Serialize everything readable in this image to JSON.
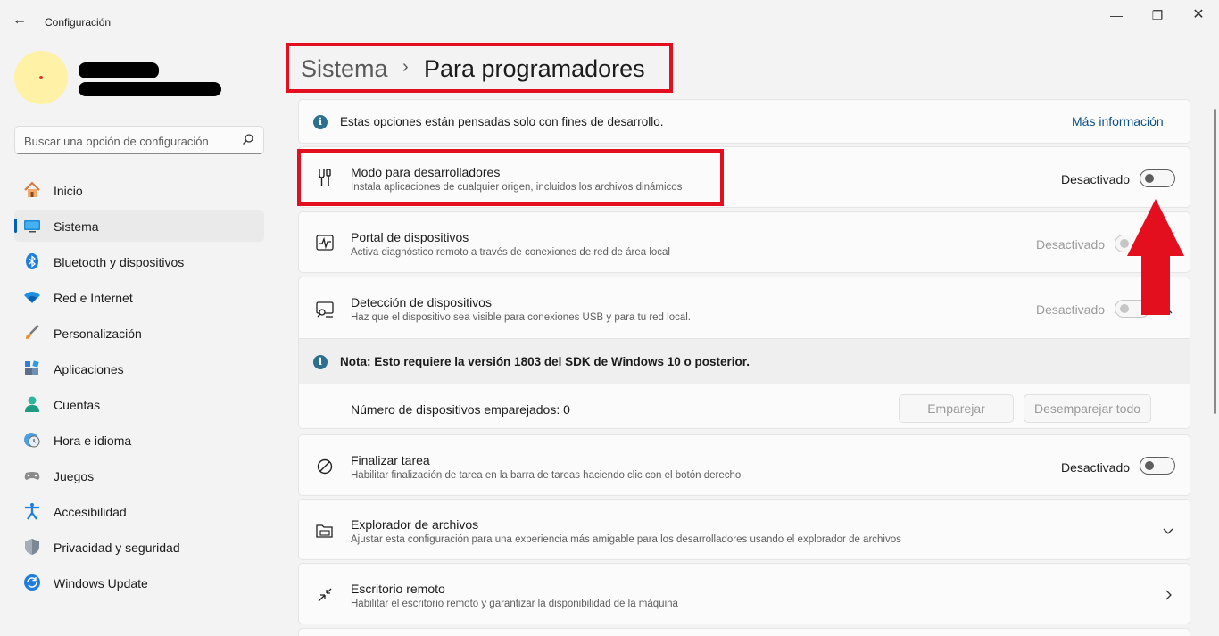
{
  "window": {
    "title": "Configuración",
    "back_glyph": "←",
    "minimize_glyph": "—",
    "maximize_glyph": "❐",
    "close_glyph": "✕"
  },
  "search": {
    "placeholder": "Buscar una opción de configuración"
  },
  "sidebar": {
    "items": [
      {
        "label": "Inicio",
        "icon": "home-icon"
      },
      {
        "label": "Sistema",
        "icon": "monitor-icon",
        "active": true
      },
      {
        "label": "Bluetooth y dispositivos",
        "icon": "bluetooth-icon"
      },
      {
        "label": "Red e Internet",
        "icon": "wifi-icon"
      },
      {
        "label": "Personalización",
        "icon": "brush-icon"
      },
      {
        "label": "Aplicaciones",
        "icon": "apps-icon"
      },
      {
        "label": "Cuentas",
        "icon": "person-icon"
      },
      {
        "label": "Hora e idioma",
        "icon": "clock-globe-icon"
      },
      {
        "label": "Juegos",
        "icon": "gamepad-icon"
      },
      {
        "label": "Accesibilidad",
        "icon": "accessibility-icon"
      },
      {
        "label": "Privacidad y seguridad",
        "icon": "shield-icon"
      },
      {
        "label": "Windows Update",
        "icon": "update-icon"
      }
    ]
  },
  "breadcrumb": {
    "parent": "Sistema",
    "separator": "›",
    "current": "Para programadores"
  },
  "info_banner": {
    "text": "Estas opciones están pensadas solo con fines de desarrollo.",
    "link": "Más información"
  },
  "settings": {
    "dev_mode": {
      "title": "Modo para desarrolladores",
      "subtitle": "Instala aplicaciones de cualquier origen, incluidos los archivos dinámicos",
      "state": "Desactivado",
      "on": false
    },
    "device_portal": {
      "title": "Portal de dispositivos",
      "subtitle": "Activa diagnóstico remoto a través de conexiones de red de área local",
      "state": "Desactivado",
      "on": false,
      "enabled": false
    },
    "device_discovery": {
      "title": "Detección de dispositivos",
      "subtitle": "Haz que el dispositivo sea visible para conexiones USB y para tu red local.",
      "state": "Desactivado",
      "on": false,
      "enabled": false,
      "note": "Nota: Esto requiere la versión 1803 del SDK de Windows 10 o posterior.",
      "paired_count_label": "Número de dispositivos emparejados: 0",
      "pair_button": "Emparejar",
      "unpair_all_button": "Desemparejar todo"
    },
    "end_task": {
      "title": "Finalizar tarea",
      "subtitle": "Habilitar finalización de tarea en la barra de tareas haciendo clic con el botón derecho",
      "state": "Desactivado",
      "on": false
    },
    "file_explorer": {
      "title": "Explorador de archivos",
      "subtitle": "Ajustar esta configuración para una experiencia más amigable para los desarrolladores usando el explorador de archivos"
    },
    "remote_desktop": {
      "title": "Escritorio remoto",
      "subtitle": "Habilitar el escritorio remoto y garantizar la disponibilidad de la máquina"
    }
  },
  "colors": {
    "annotation_red": "#e30f1f",
    "accent": "#005fb8",
    "info_icon": "#2d6f8f"
  }
}
